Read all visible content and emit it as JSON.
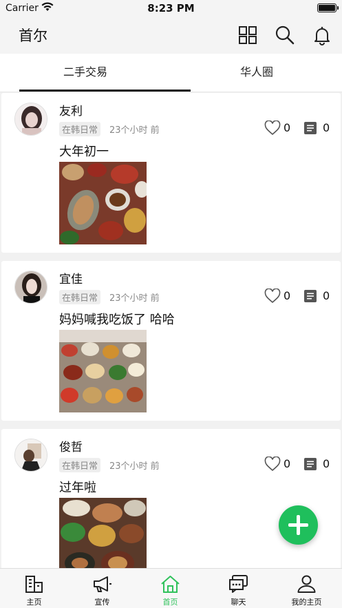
{
  "status_bar": {
    "carrier": "Carrier",
    "time": "8:23 PM"
  },
  "header": {
    "title": "首尔",
    "icons": [
      "grid-icon",
      "search-icon",
      "bell-icon"
    ]
  },
  "tabs": [
    {
      "label": "二手交易",
      "active": true
    },
    {
      "label": "华人圈",
      "active": false
    }
  ],
  "posts": [
    {
      "username": "友利",
      "tag": "在韩日常",
      "time": "23个小时 前",
      "likes": "0",
      "comments": "0",
      "text": "大年初一"
    },
    {
      "username": "宜佳",
      "tag": "在韩日常",
      "time": "23个小时 前",
      "likes": "0",
      "comments": "0",
      "text": "妈妈喊我吃饭了  哈哈"
    },
    {
      "username": "俊哲",
      "tag": "在韩日常",
      "time": "23个小时 前",
      "likes": "0",
      "comments": "0",
      "text": "过年啦"
    }
  ],
  "fab": {
    "icon": "plus-icon"
  },
  "tabbar": [
    {
      "label": "主页",
      "icon": "building-icon",
      "active": false
    },
    {
      "label": "宣传",
      "icon": "megaphone-icon",
      "active": false
    },
    {
      "label": "首页",
      "icon": "home-icon",
      "active": true
    },
    {
      "label": "聊天",
      "icon": "chat-icon",
      "active": false
    },
    {
      "label": "我的主页",
      "icon": "user-icon",
      "active": false
    }
  ],
  "colors": {
    "accent": "#2fc25b",
    "fab": "#1fbf5c",
    "background": "#f1f1f1"
  }
}
